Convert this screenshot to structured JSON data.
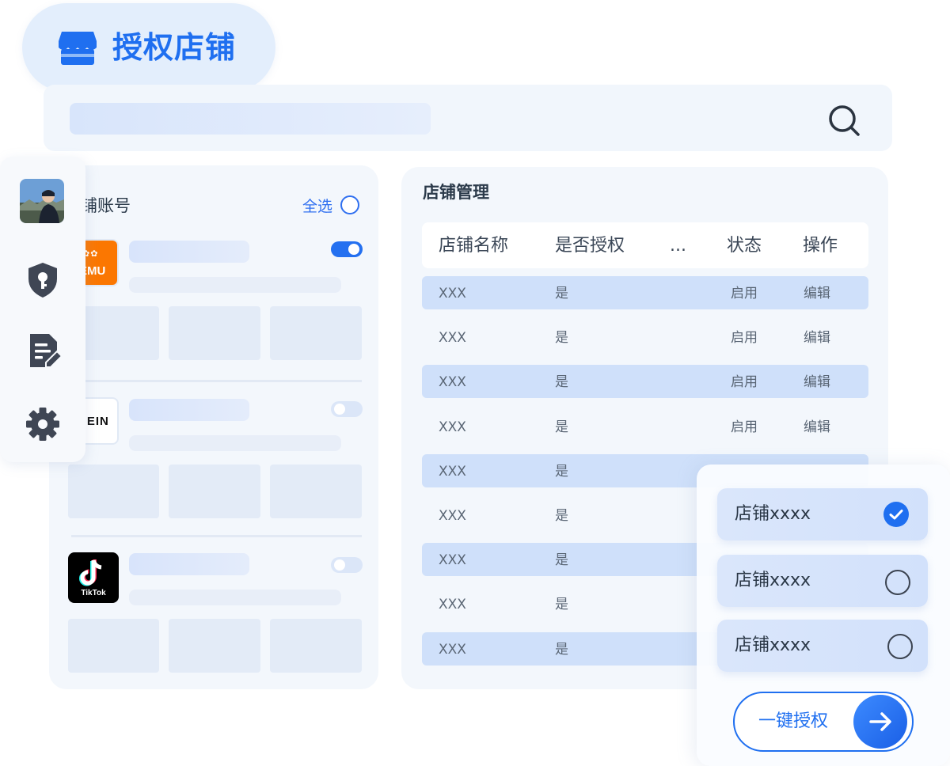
{
  "title": {
    "text": "授权店铺"
  },
  "search": {
    "placeholder": ""
  },
  "accounts_panel": {
    "heading": "铺账号",
    "select_all": "全选",
    "shops": [
      {
        "logo": "EMU",
        "toggle_on": true
      },
      {
        "logo": "HEIN",
        "toggle_on": false
      },
      {
        "logo": "TikTok",
        "toggle_on": false
      }
    ]
  },
  "sidebar": {
    "items": [
      "avatar",
      "shield-key-icon",
      "document-edit-icon",
      "gear-icon"
    ]
  },
  "management": {
    "title": "店铺管理",
    "columns": [
      "店铺名称",
      "是否授权",
      "...",
      "状态",
      "操作"
    ],
    "rows": [
      {
        "name": "XXX",
        "authorized": "是",
        "status": "启用",
        "action": "编辑"
      },
      {
        "name": "XXX",
        "authorized": "是",
        "status": "启用",
        "action": "编辑"
      },
      {
        "name": "XXX",
        "authorized": "是",
        "status": "启用",
        "action": "编辑"
      },
      {
        "name": "XXX",
        "authorized": "是",
        "status": "启用",
        "action": "编辑"
      },
      {
        "name": "XXX",
        "authorized": "是",
        "status": "",
        "action": ""
      },
      {
        "name": "XXX",
        "authorized": "是",
        "status": "",
        "action": ""
      },
      {
        "name": "XXX",
        "authorized": "是",
        "status": "",
        "action": ""
      },
      {
        "name": "XXX",
        "authorized": "是",
        "status": "",
        "action": ""
      },
      {
        "name": "XXX",
        "authorized": "是",
        "status": "",
        "action": ""
      }
    ]
  },
  "popup": {
    "options": [
      {
        "label": "店铺xxxx",
        "checked": true
      },
      {
        "label": "店铺xxxx",
        "checked": false
      },
      {
        "label": "店铺xxxx",
        "checked": false
      }
    ],
    "button_label": "一键授权"
  },
  "colors": {
    "brand": "#1f6ff0",
    "row_highlight": "#cfe0fa",
    "panel_bg": "#f3f7fc"
  }
}
